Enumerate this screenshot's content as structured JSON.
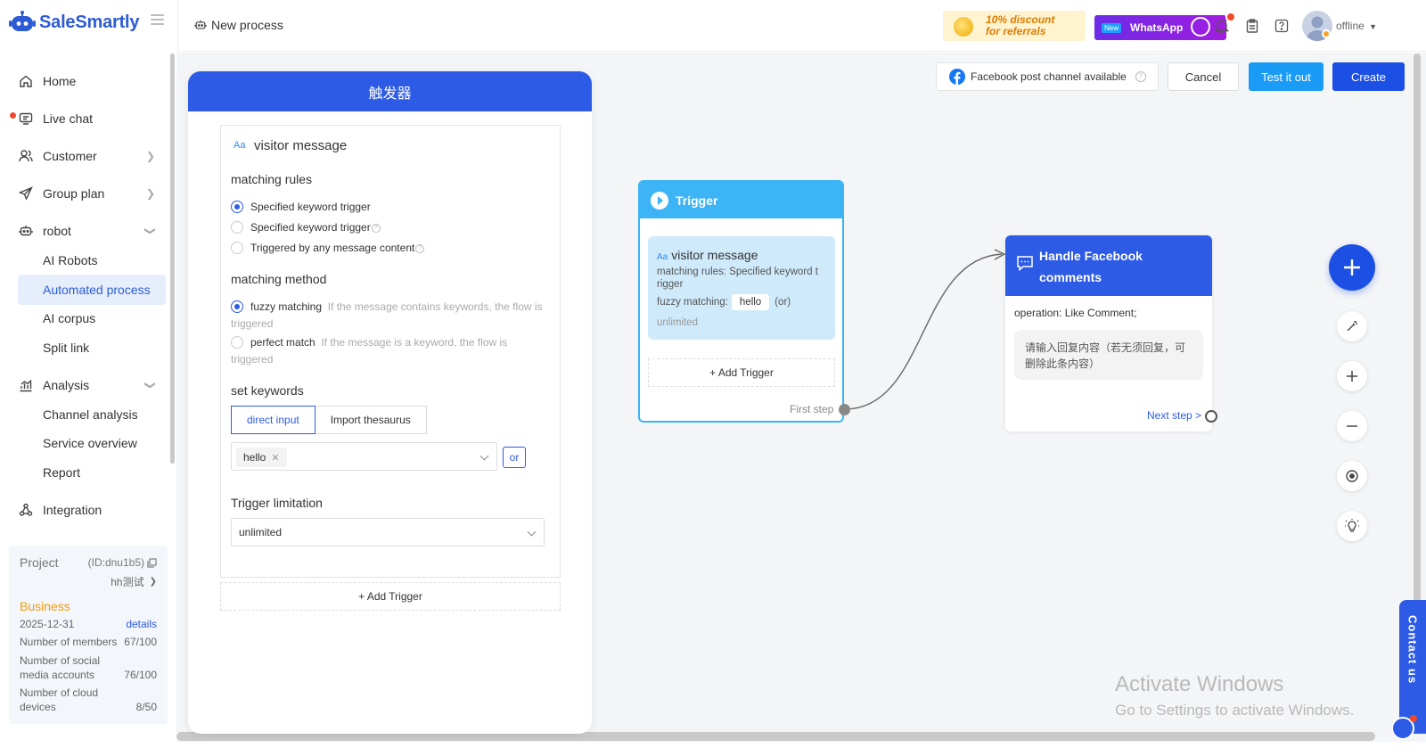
{
  "app": {
    "name": "SaleSmartly",
    "page_title": "New process"
  },
  "sidebar": {
    "items": [
      {
        "label": "Home",
        "icon": "home-icon"
      },
      {
        "label": "Live chat",
        "icon": "chat-icon"
      },
      {
        "label": "Customer",
        "icon": "users-icon"
      },
      {
        "label": "Group plan",
        "icon": "send-icon"
      },
      {
        "label": "robot",
        "icon": "robot-icon"
      },
      {
        "label": "Analysis",
        "icon": "chart-icon"
      },
      {
        "label": "Integration",
        "icon": "integration-icon"
      }
    ],
    "robot_sub": [
      "AI Robots",
      "Automated process",
      "AI corpus",
      "Split link"
    ],
    "analysis_sub": [
      "Channel analysis",
      "Service overview",
      "Report"
    ],
    "active_item": "Automated process"
  },
  "project": {
    "label": "Project",
    "id": "(ID:dnu1b5)",
    "name": "hh测试",
    "plan": "Business",
    "expiry": "2025-12-31",
    "details_link": "details",
    "members_label": "Number of members",
    "members_value": "67/100",
    "social_label": "Number of social media accounts",
    "social_value": "76/100",
    "cloud_label": "Number of cloud devices",
    "cloud_value": "8/50"
  },
  "topbar": {
    "promo_referral_line1": "10% discount",
    "promo_referral_line2": "for referrals",
    "promo_new_badge": "New",
    "promo_whatsapp": "WhatsApp",
    "status": "offline"
  },
  "actions": {
    "fb_notice": "Facebook post channel available",
    "cancel": "Cancel",
    "test": "Test it out",
    "create": "Create"
  },
  "trigger_panel": {
    "title": "触发器",
    "card_icon": "Aa",
    "card_title": "visitor message",
    "matching_rules_label": "matching rules",
    "rules": [
      "Specified keyword trigger",
      "Specified keyword trigger",
      "Triggered by any message content"
    ],
    "selected_rule_index": 0,
    "matching_method_label": "matching method",
    "methods": [
      {
        "name": "fuzzy matching",
        "hint": "If the message contains keywords, the flow is triggered"
      },
      {
        "name": "perfect match",
        "hint": "If the message is a keyword, the flow is triggered"
      }
    ],
    "selected_method_index": 0,
    "set_keywords_label": "set keywords",
    "tabs": [
      "direct input",
      "Import thesaurus"
    ],
    "active_tab": "direct input",
    "keywords": [
      "hello"
    ],
    "or_label": "or",
    "trigger_limitation_label": "Trigger limitation",
    "trigger_limitation_value": "unlimited",
    "add_trigger": "+ Add Trigger"
  },
  "flow": {
    "trigger_node": {
      "title": "Trigger",
      "card_icon": "Aa",
      "card_title": "visitor message",
      "rules_line": "matching rules: Specified keyword t rigger",
      "method_label": "fuzzy matching:",
      "keyword": "hello",
      "or_text": "(or)",
      "limit": "unlimited",
      "add_trigger": "+ Add Trigger",
      "first_step": "First step"
    },
    "fb_node": {
      "title_line1": "Handle Facebook",
      "title_line2": "comments",
      "operation": "operation: Like Comment;",
      "reply_placeholder": "请输入回复内容（若无须回复，可删除此条内容）",
      "next_step": "Next step >"
    }
  },
  "watermark": {
    "line1": "Activate Windows",
    "line2": "Go to Settings to activate Windows."
  },
  "contact_us": "Contact us",
  "colors": {
    "primary": "#2d5be6",
    "trigger": "#3cb4f5",
    "test_button": "#1a9bf6",
    "create_button": "#1c4fe3"
  }
}
